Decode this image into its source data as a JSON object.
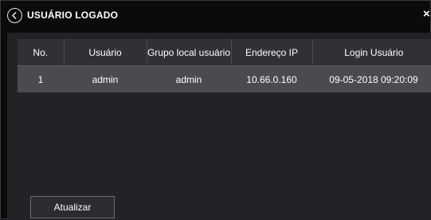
{
  "dialog": {
    "title": "USUÁRIO LOGADO",
    "back_icon": "chevron-left-circle-icon",
    "close_label": "×"
  },
  "table": {
    "columns": [
      "No.",
      "Usuário",
      "Grupo local usuário",
      "Endereço IP",
      "Login Usuário"
    ],
    "rows": [
      {
        "no": "1",
        "usuario": "admin",
        "grupo": "admin",
        "ip": "10.66.0.160",
        "login": "09-05-2018 09:20:09"
      }
    ]
  },
  "footer": {
    "refresh_label": "Atualizar"
  }
}
